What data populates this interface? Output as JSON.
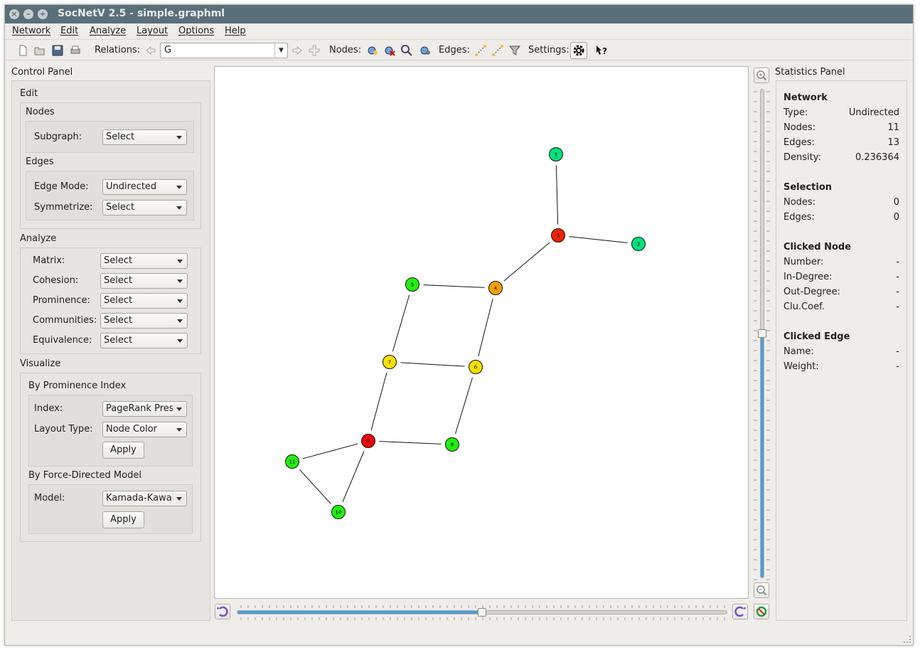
{
  "window": {
    "title": "SocNetV 2.5 - simple.graphml"
  },
  "menu": [
    "Network",
    "Edit",
    "Analyze",
    "Layout",
    "Options",
    "Help"
  ],
  "toolbar": {
    "relations_label": "Relations:",
    "relation_value": "G",
    "nodes_label": "Nodes:",
    "edges_label": "Edges:",
    "settings_label": "Settings:"
  },
  "control_panel": {
    "title": "Control Panel",
    "edit": {
      "title": "Edit",
      "nodes_title": "Nodes",
      "subgraph_label": "Subgraph:",
      "subgraph_value": "Select",
      "edges_title": "Edges",
      "edge_mode_label": "Edge Mode:",
      "edge_mode_value": "Undirected",
      "symmetrize_label": "Symmetrize:",
      "symmetrize_value": "Select"
    },
    "analyze": {
      "title": "Analyze",
      "rows": [
        {
          "label": "Matrix:",
          "value": "Select"
        },
        {
          "label": "Cohesion:",
          "value": "Select"
        },
        {
          "label": "Prominence:",
          "value": "Select"
        },
        {
          "label": "Communities:",
          "value": "Select"
        },
        {
          "label": "Equivalence:",
          "value": "Select"
        }
      ]
    },
    "visualize": {
      "title": "Visualize",
      "prominence_title": "By Prominence Index",
      "index_label": "Index:",
      "index_value": "PageRank Prestige",
      "layout_type_label": "Layout Type:",
      "layout_type_value": "Node Color",
      "apply_label": "Apply",
      "force_title": "By Force-Directed Model",
      "model_label": "Model:",
      "model_value": "Kamada-Kawai",
      "apply2_label": "Apply"
    }
  },
  "statistics": {
    "title": "Statistics Panel",
    "network_title": "Network",
    "network": [
      {
        "label": "Type:",
        "value": "Undirected"
      },
      {
        "label": "Nodes:",
        "value": "11"
      },
      {
        "label": "Edges:",
        "value": "13"
      },
      {
        "label": "Density:",
        "value": "0.236364"
      }
    ],
    "selection_title": "Selection",
    "selection": [
      {
        "label": "Nodes:",
        "value": "0"
      },
      {
        "label": "Edges:",
        "value": "0"
      }
    ],
    "clicked_node_title": "Clicked Node",
    "clicked_node": [
      {
        "label": "Number:",
        "value": "-"
      },
      {
        "label": "In-Degree:",
        "value": "-"
      },
      {
        "label": "Out-Degree:",
        "value": "-"
      },
      {
        "label": "Clu.Coef.",
        "value": "-"
      }
    ],
    "clicked_edge_title": "Clicked Edge",
    "clicked_edge": [
      {
        "label": "Name:",
        "value": "-"
      },
      {
        "label": "Weight:",
        "value": "-"
      }
    ]
  },
  "graph": {
    "nodes": [
      {
        "id": "1",
        "color": "#00e07a"
      },
      {
        "id": "2",
        "color": "#00e07a"
      },
      {
        "id": "3",
        "color": "#ee2200"
      },
      {
        "id": "4",
        "color": "#f5a000"
      },
      {
        "id": "5",
        "color": "#22ee11"
      },
      {
        "id": "6",
        "color": "#f5e000"
      },
      {
        "id": "7",
        "color": "#f5e000"
      },
      {
        "id": "8",
        "color": "#22ee11"
      },
      {
        "id": "9",
        "color": "#ee0000"
      },
      {
        "id": "10",
        "color": "#22ee11"
      },
      {
        "id": "11",
        "color": "#22ee11"
      }
    ],
    "edges": [
      [
        "1",
        "3"
      ],
      [
        "3",
        "2"
      ],
      [
        "3",
        "4"
      ],
      [
        "4",
        "5"
      ],
      [
        "4",
        "6"
      ],
      [
        "5",
        "7"
      ],
      [
        "7",
        "6"
      ],
      [
        "6",
        "8"
      ],
      [
        "7",
        "9"
      ],
      [
        "9",
        "8"
      ],
      [
        "9",
        "11"
      ],
      [
        "9",
        "10"
      ],
      [
        "11",
        "10"
      ]
    ]
  },
  "zoom": {
    "vertical_level": 0.5,
    "horizontal_level": 0.5
  }
}
